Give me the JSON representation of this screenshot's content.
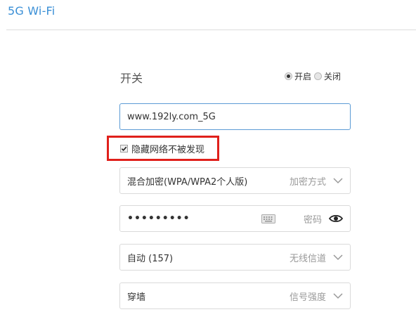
{
  "page": {
    "title": "5G Wi-Fi"
  },
  "switch": {
    "label": "开关",
    "options": [
      {
        "label": "开启",
        "checked": true
      },
      {
        "label": "关闭",
        "checked": false
      }
    ]
  },
  "ssid": {
    "value": "www.192ly.com_5G"
  },
  "hide_network": {
    "label": "隐藏网络不被发现",
    "checked": true
  },
  "encryption": {
    "value": "混合加密(WPA/WPA2个人版)",
    "hint": "加密方式"
  },
  "password": {
    "value": "•••••••••",
    "hint": "密码"
  },
  "channel": {
    "value": "自动 (157)",
    "hint": "无线信道"
  },
  "signal": {
    "value": "穿墙",
    "hint": "信号强度"
  },
  "colors": {
    "accent": "#3a8fd6",
    "highlight_border": "#e0201b",
    "focus_border": "#5b9bd5"
  }
}
